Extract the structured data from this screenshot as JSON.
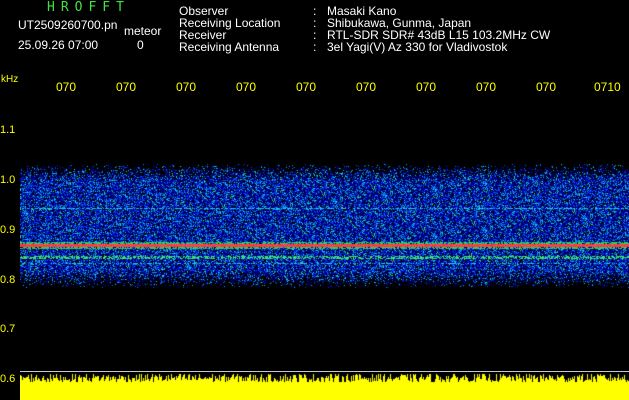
{
  "header": {
    "app_title": "HROFFT",
    "file_name": "UT2509260700.pn",
    "meteor_label": "meteor",
    "date_time": "25.09.26 07:00",
    "count": "0",
    "info": [
      {
        "label": "Observer",
        "sep": ":",
        "value": "Masaki Kano"
      },
      {
        "label": "Receiving Location",
        "sep": ":",
        "value": "Shibukawa, Gunma, Japan"
      },
      {
        "label": "Receiver",
        "sep": ":",
        "value": "RTL-SDR SDR# 43dB L15 103.2MHz CW"
      },
      {
        "label": "Receiving Antenna",
        "sep": ":",
        "value": "3el Yagi(V) Az 330 for Vladivostok"
      }
    ]
  },
  "axis": {
    "unit": "kHz",
    "y_ticks": [
      "1.1",
      "1.0",
      "0.9",
      "0.8",
      "0.7",
      "0.6"
    ],
    "x_ticks": [
      "070",
      "070",
      "070",
      "070",
      "070",
      "070",
      "070",
      "070",
      "070",
      "0710"
    ]
  },
  "colors": {
    "background": "#000000",
    "axis_text": "#ffff00",
    "title_green": "#3fe23f",
    "signal_band": "#ff2b2b",
    "meter": "#ffff00"
  }
}
